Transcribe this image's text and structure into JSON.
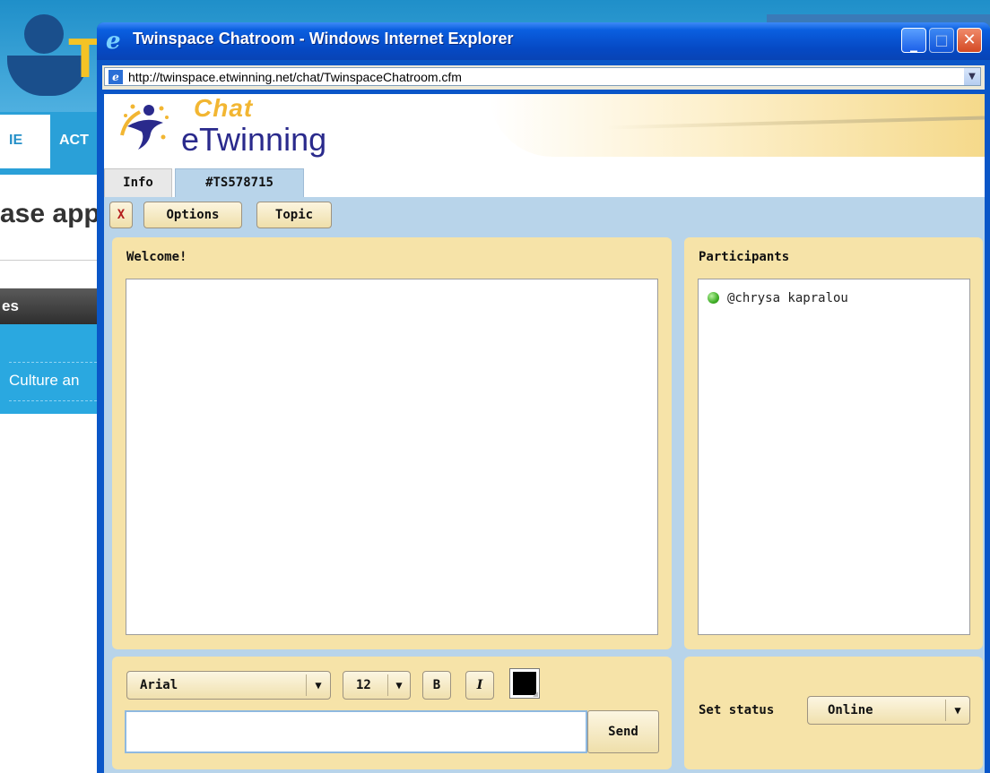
{
  "background_page": {
    "nav_tab_home": "IE",
    "nav_tab_activities": "ACT",
    "heading": "ase app",
    "sidebar_heading": "es",
    "sidebar_item": "Culture an"
  },
  "window": {
    "title": "Twinspace Chatroom - Windows Internet Explorer",
    "url": "http://twinspace.etwinning.net/chat/TwinspaceChatroom.cfm",
    "icons": {
      "browser": "ie-logo-icon",
      "minimize": "minimize-icon",
      "maximize": "maximize-icon",
      "close": "close-icon"
    }
  },
  "logo": {
    "chat": "Chat",
    "brand": "eTwinning"
  },
  "tabs": [
    {
      "label": "Info",
      "active": false
    },
    {
      "label": "#TS578715",
      "active": true
    }
  ],
  "toolbar": {
    "close_label": "X",
    "options_label": "Options",
    "topic_label": "Topic"
  },
  "chat": {
    "welcome_title": "Welcome!",
    "messages": []
  },
  "participants": {
    "title": "Participants",
    "list": [
      {
        "name": "@chrysa kapralou",
        "status_color": "#3fae26"
      }
    ]
  },
  "composer": {
    "font": "Arial",
    "font_size": "12",
    "bold_label": "B",
    "italic_label": "I",
    "text_color": "#000000",
    "message_value": "",
    "send_label": "Send"
  },
  "status": {
    "label": "Set status",
    "value": "Online"
  }
}
